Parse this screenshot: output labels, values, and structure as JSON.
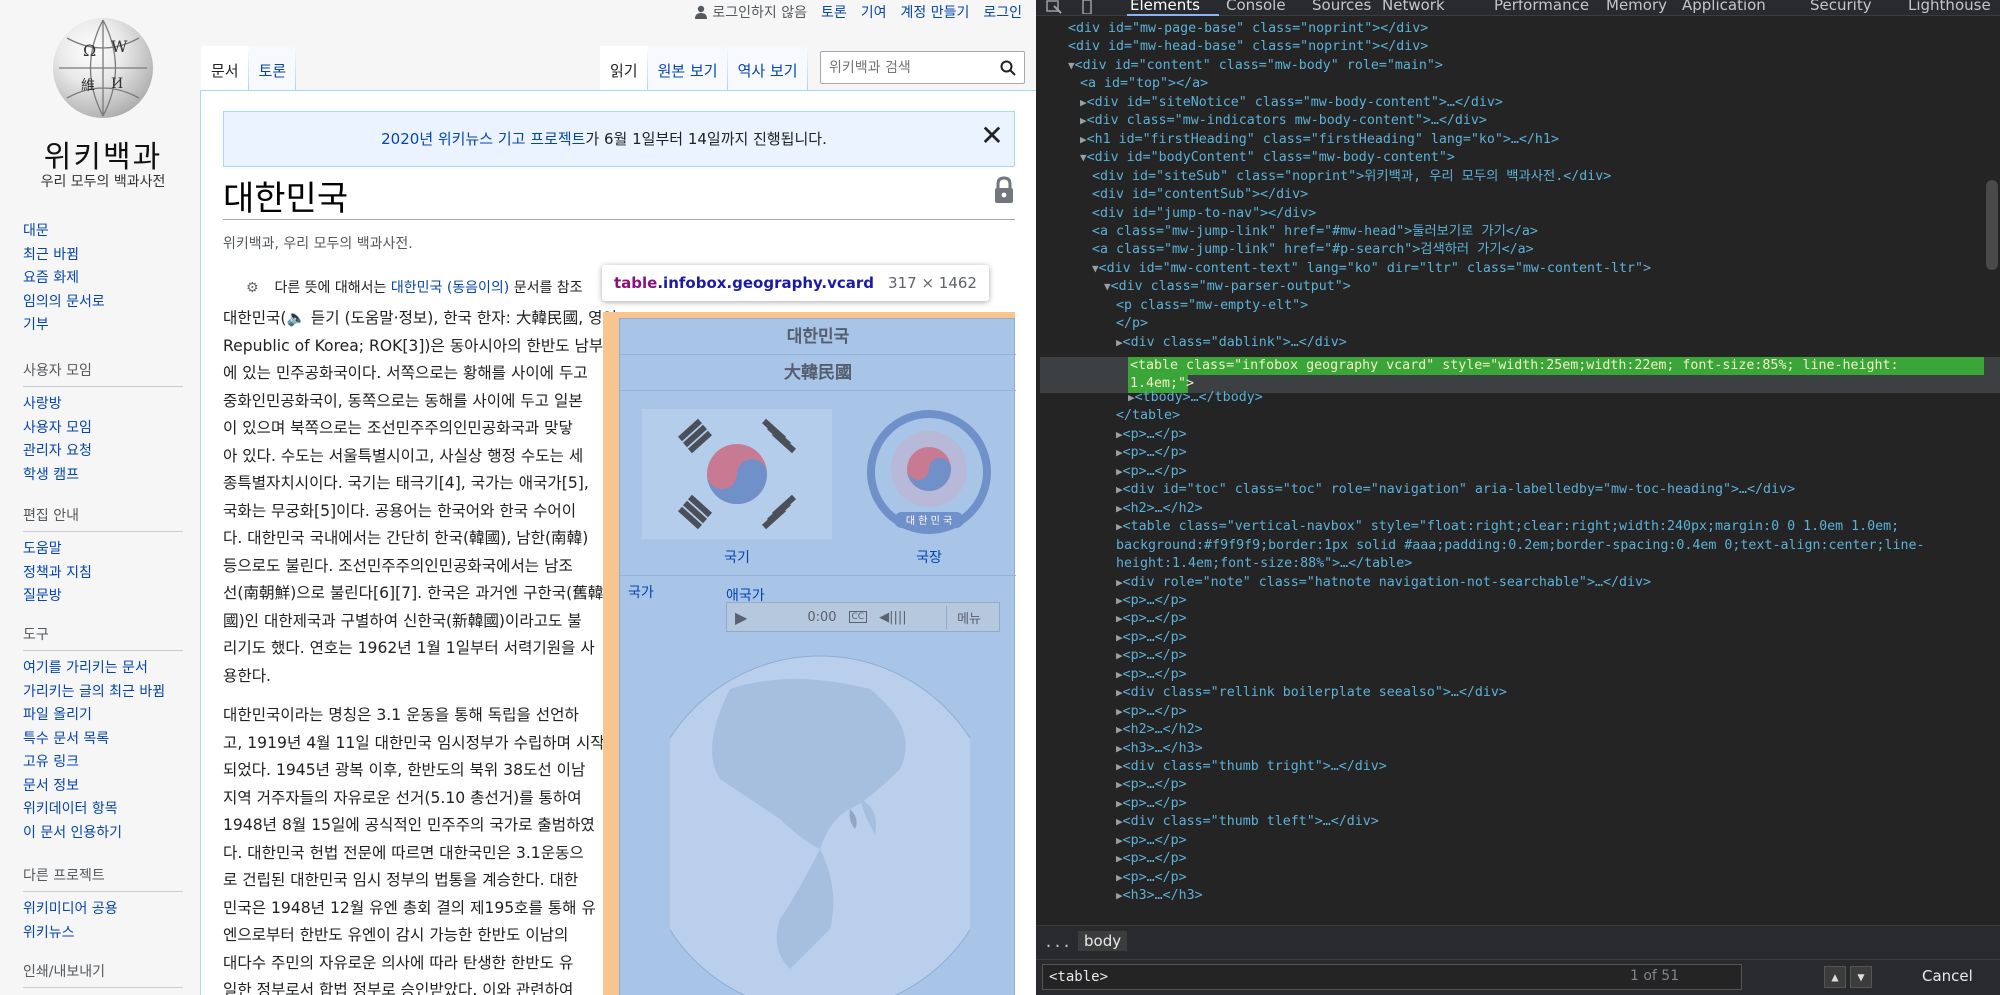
{
  "wiki": {
    "user_links": [
      "로그인하지 않음",
      "토론",
      "기여",
      "계정 만들기",
      "로그인"
    ],
    "logo": {
      "title": "위키백과",
      "tagline": "우리 모두의 백과사전"
    },
    "nav_main": [
      "대문",
      "최근 바뀜",
      "요즘 화제",
      "임의의 문서로",
      "기부"
    ],
    "community": {
      "heading": "사용자 모임",
      "items": [
        "사랑방",
        "사용자 모임",
        "관리자 요청",
        "학생 캠프"
      ]
    },
    "guide": {
      "heading": "편집 안내",
      "items": [
        "도움말",
        "정책과 지침",
        "질문방"
      ]
    },
    "tools": {
      "heading": "도구",
      "items": [
        "여기를 가리키는 문서",
        "가리키는 글의 최근 바뀜",
        "파일 올리기",
        "특수 문서 목록",
        "고유 링크",
        "문서 정보",
        "위키데이터 항목",
        "이 문서 인용하기"
      ]
    },
    "other_projects": {
      "heading": "다른 프로젝트",
      "items": [
        "위키미디어 공용",
        "위키뉴스"
      ]
    },
    "print_export": {
      "heading": "인쇄/내보내기"
    },
    "tabs_left": [
      "문서",
      "토론"
    ],
    "tabs_right": [
      "읽기",
      "원본 보기",
      "역사 보기"
    ],
    "search": {
      "placeholder": "위키백과 검색"
    },
    "notice": {
      "link": "2020년 위키뉴스 기고 프로젝트",
      "text": "가 6월 1일부터 14일까지 진행됩니다.",
      "close": "✕"
    },
    "page_title": "대한민국",
    "site_sub": "위키백과, 우리 모두의 백과사전.",
    "hatnote": {
      "pre": "다른 뜻에 대해서는 ",
      "link": "대한민국 (동음이의)",
      "post": " 문서를 참조"
    },
    "intro_lines": [
      "대한민국(🔈 듣기 (도움말·정보), 한국 한자: 大韓民國, 영어:",
      "Republic of Korea; ROK[3])은 동아시아의 한반도 남부",
      "에 있는 민주공화국이다. 서쪽으로는 황해를 사이에 두고",
      "중화인민공화국이, 동쪽으로는 동해를 사이에 두고 일본",
      "이 있으며 북쪽으로는 조선민주주의인민공화국과 맞닿",
      "아 있다. 수도는 서울특별시이고, 사실상 행정 수도는 세",
      "종특별자치시이다. 국기는 태극기[4], 국가는 애국가[5],",
      "국화는 무궁화[5]이다. 공용어는 한국어와 한국 수어이",
      "다. 대한민국 국내에서는 간단히 한국(韓國), 남한(南韓)",
      "등으로도 불린다. 조선민주주의인민공화국에서는 남조",
      "선(南朝鮮)으로 불린다[6][7]. 한국은 과거엔 구한국(舊韓",
      "國)인 대한제국과 구별하여 신한국(新韓國)이라고도 불",
      "리기도 했다. 연호는 1962년 1월 1일부터 서력기원을 사",
      "용한다."
    ],
    "para2_lines": [
      "대한민국이라는 명칭은 3.1 운동을 통해 독립을 선언하",
      "고, 1919년 4월 11일 대한민국 임시정부가 수립하며 시작",
      "되었다. 1945년 광복 이후, 한반도의 북위 38도선 이남",
      "지역 거주자들의 자유로운 선거(5.10 총선거)를 통하여",
      "1948년 8월 15일에 공식적인 민주주의 국가로 출범하였",
      "다. 대한민국 헌법 전문에 따르면 대한국민은 3.1운동으",
      "로 건립된 대한민국 임시 정부의 법통을 계승한다. 대한",
      "민국은 1948년 12월 유엔 총회 결의 제195호를 통해 유",
      "엔으로부터 한반도 유엔이 감시 가능한 한반도 이남의",
      "대다수 주민의 자유로운 의사에 따라 탄생한 한반도 유",
      "일한 정부로서 합법 정부로 승인받았다. 이와 관련하여"
    ],
    "infobox": {
      "name": "대한민국",
      "hanja": "大韓民國",
      "flag_caption": "국기",
      "emblem_caption": "국장",
      "anthem_label": "국가",
      "anthem_name": "애국가",
      "audio_time": "0:00",
      "audio_menu": "메뉴",
      "emblem_text": "대 한 민 국"
    },
    "tooltip": {
      "tag": "table",
      "classes": ".infobox.geography.vcard",
      "dims": "317 × 1462"
    }
  },
  "devtools": {
    "tabs": [
      "Elements",
      "Console",
      "Sources",
      "Network",
      "Performance",
      "Memory",
      "Application",
      "Security",
      "Lighthouse"
    ],
    "active_tab": "Elements",
    "breadcrumb": [
      "...",
      "body"
    ],
    "find": {
      "value": "<table>",
      "count": "1 of 51",
      "cancel": "Cancel"
    },
    "selected_line_1": "<table class=\"infobox geography vcard\" style=\"width:25em;width:22em; font-size:85%; line-height:",
    "selected_line_2": "1.4em;\">",
    "tree": [
      {
        "i": 2,
        "a": "",
        "t": "<div id=\"mw-page-base\" class=\"noprint\"></div>"
      },
      {
        "i": 2,
        "a": "",
        "t": "<div id=\"mw-head-base\" class=\"noprint\"></div>"
      },
      {
        "i": 2,
        "a": "▼",
        "t": "<div id=\"content\" class=\"mw-body\" role=\"main\">"
      },
      {
        "i": 3,
        "a": "",
        "t": "<a id=\"top\"></a>"
      },
      {
        "i": 3,
        "a": "▶",
        "t": "<div id=\"siteNotice\" class=\"mw-body-content\">…</div>"
      },
      {
        "i": 3,
        "a": "▶",
        "t": "<div class=\"mw-indicators mw-body-content\">…</div>"
      },
      {
        "i": 3,
        "a": "▶",
        "t": "<h1 id=\"firstHeading\" class=\"firstHeading\" lang=\"ko\">…</h1>"
      },
      {
        "i": 3,
        "a": "▼",
        "t": "<div id=\"bodyContent\" class=\"mw-body-content\">"
      },
      {
        "i": 4,
        "a": "",
        "t": "<div id=\"siteSub\" class=\"noprint\">위키백과, 우리 모두의 백과사전.</div>"
      },
      {
        "i": 4,
        "a": "",
        "t": "<div id=\"contentSub\"></div>"
      },
      {
        "i": 4,
        "a": "",
        "t": "<div id=\"jump-to-nav\"></div>"
      },
      {
        "i": 4,
        "a": "",
        "t": "<a class=\"mw-jump-link\" href=\"#mw-head\">둘러보기로 가기</a>"
      },
      {
        "i": 4,
        "a": "",
        "t": "<a class=\"mw-jump-link\" href=\"#p-search\">검색하러 가기</a>"
      },
      {
        "i": 4,
        "a": "▼",
        "t": "<div id=\"mw-content-text\" lang=\"ko\" dir=\"ltr\" class=\"mw-content-ltr\">"
      },
      {
        "i": 5,
        "a": "▼",
        "t": "<div class=\"mw-parser-output\">"
      },
      {
        "i": 6,
        "a": "",
        "t": "<p class=\"mw-empty-elt\">"
      },
      {
        "i": 6,
        "a": "",
        "t": "</p>"
      },
      {
        "i": 6,
        "a": "▶",
        "t": "<div class=\"dablink\">…</div>"
      },
      {
        "i": 6,
        "a": "",
        "t": ""
      },
      {
        "i": 6,
        "a": "",
        "t": ""
      },
      {
        "i": 7,
        "a": "▶",
        "t": "<tbody>…</tbody>"
      },
      {
        "i": 6,
        "a": "",
        "t": "</table>"
      },
      {
        "i": 6,
        "a": "▶",
        "t": "<p>…</p>"
      },
      {
        "i": 6,
        "a": "▶",
        "t": "<p>…</p>"
      },
      {
        "i": 6,
        "a": "▶",
        "t": "<p>…</p>"
      },
      {
        "i": 6,
        "a": "▶",
        "t": "<div id=\"toc\" class=\"toc\" role=\"navigation\" aria-labelledby=\"mw-toc-heading\">…</div>"
      },
      {
        "i": 6,
        "a": "▶",
        "t": "<h2>…</h2>"
      },
      {
        "i": 6,
        "a": "▶",
        "t": "<table class=\"vertical-navbox\" style=\"float:right;clear:right;width:240px;margin:0 0 1.0em 1.0em;"
      },
      {
        "i": 6,
        "a": "",
        "t": "background:#f9f9f9;border:1px solid #aaa;padding:0.2em;border-spacing:0.4em 0;text-align:center;line-"
      },
      {
        "i": 6,
        "a": "",
        "t": "height:1.4em;font-size:88%\">…</table>"
      },
      {
        "i": 6,
        "a": "▶",
        "t": "<div role=\"note\" class=\"hatnote navigation-not-searchable\">…</div>"
      },
      {
        "i": 6,
        "a": "▶",
        "t": "<p>…</p>"
      },
      {
        "i": 6,
        "a": "▶",
        "t": "<p>…</p>"
      },
      {
        "i": 6,
        "a": "▶",
        "t": "<p>…</p>"
      },
      {
        "i": 6,
        "a": "▶",
        "t": "<p>…</p>"
      },
      {
        "i": 6,
        "a": "▶",
        "t": "<p>…</p>"
      },
      {
        "i": 6,
        "a": "▶",
        "t": "<div class=\"rellink boilerplate seealso\">…</div>"
      },
      {
        "i": 6,
        "a": "▶",
        "t": "<p>…</p>"
      },
      {
        "i": 6,
        "a": "▶",
        "t": "<h2>…</h2>"
      },
      {
        "i": 6,
        "a": "▶",
        "t": "<h3>…</h3>"
      },
      {
        "i": 6,
        "a": "▶",
        "t": "<div class=\"thumb tright\">…</div>"
      },
      {
        "i": 6,
        "a": "▶",
        "t": "<p>…</p>"
      },
      {
        "i": 6,
        "a": "▶",
        "t": "<p>…</p>"
      },
      {
        "i": 6,
        "a": "▶",
        "t": "<div class=\"thumb tleft\">…</div>"
      },
      {
        "i": 6,
        "a": "▶",
        "t": "<p>…</p>"
      },
      {
        "i": 6,
        "a": "▶",
        "t": "<p>…</p>"
      },
      {
        "i": 6,
        "a": "▶",
        "t": "<p>…</p>"
      },
      {
        "i": 6,
        "a": "▶",
        "t": "<h3>…</h3>"
      }
    ],
    "colors": {
      "background": "#242424",
      "selection_green": "#3aa63a",
      "tag": "#5db0d7",
      "attr_value": "#f29766"
    }
  }
}
